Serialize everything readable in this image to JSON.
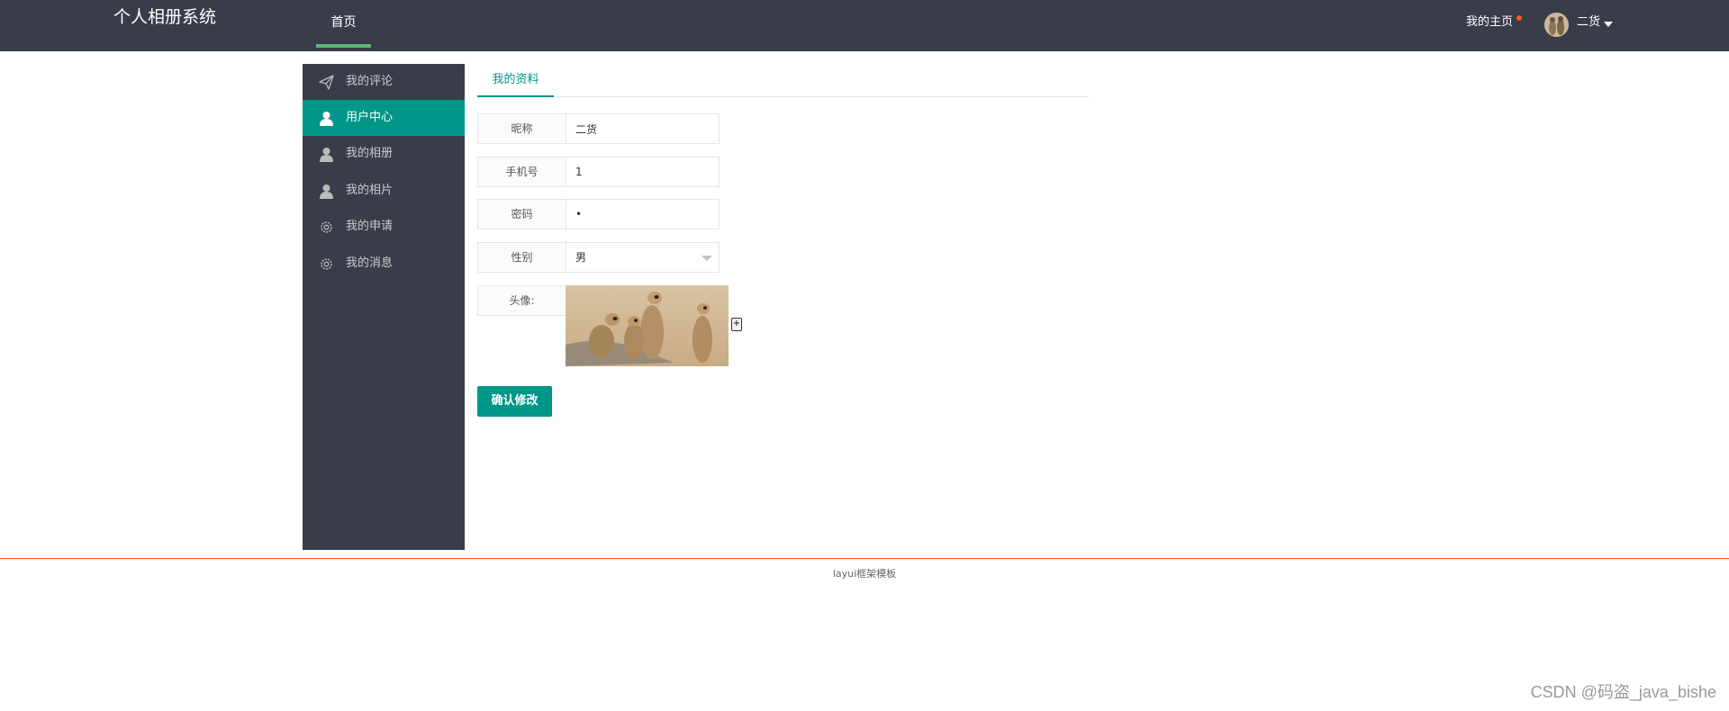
{
  "app_title": "个人相册系统",
  "header": {
    "nav_home": "首页",
    "my_home": "我的主页",
    "user_name": "二货"
  },
  "sidebar": {
    "items": [
      {
        "label": "我的评论",
        "icon": "paper-plane-icon"
      },
      {
        "label": "用户中心",
        "icon": "user-icon",
        "active": true
      },
      {
        "label": "我的相册",
        "icon": "user-icon"
      },
      {
        "label": "我的相片",
        "icon": "user-icon"
      },
      {
        "label": "我的申请",
        "icon": "gear-icon"
      },
      {
        "label": "我的消息",
        "icon": "gear-icon"
      }
    ]
  },
  "tab": {
    "label": "我的资料"
  },
  "form": {
    "nickname": {
      "label": "昵称",
      "value": "二货"
    },
    "phone": {
      "label": "手机号",
      "value": "1"
    },
    "password": {
      "label": "密码",
      "value": "•"
    },
    "gender": {
      "label": "性别",
      "value": "男"
    },
    "avatar": {
      "label": "头像:",
      "add_button": "+"
    }
  },
  "submit_label": "确认修改",
  "footer": "layui框架模板",
  "watermark": "CSDN @码盗_java_bishe",
  "colors": {
    "header_bg": "#393d49",
    "accent": "#009688",
    "nav_indicator": "#5fb878",
    "footer_line": "#ff5722"
  }
}
